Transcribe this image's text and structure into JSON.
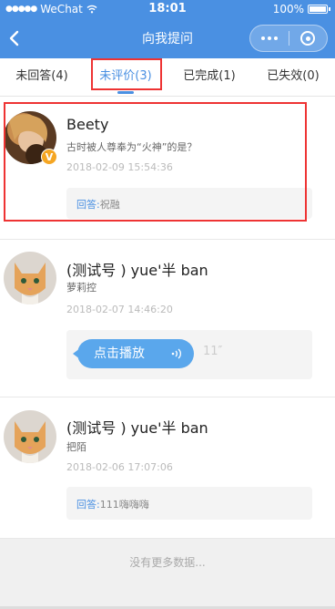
{
  "status_bar": {
    "carrier": "WeChat",
    "time": "18:01",
    "battery_text": "100%",
    "battery_level": 1.0
  },
  "nav": {
    "title": "向我提问",
    "back_icon": "chevron-left-icon",
    "more_icon": "more-dots-icon",
    "close_icon": "target-close-icon"
  },
  "tabs": [
    {
      "label": "未回答(4)",
      "active": false
    },
    {
      "label": "未评价(3)",
      "active": true
    },
    {
      "label": "已完成(1)",
      "active": false
    },
    {
      "label": "已失效(0)",
      "active": false
    }
  ],
  "items": [
    {
      "name": "Beety",
      "question": "古时被人尊奉为“火神”的是？",
      "date": "2018-02-09 15:54:36",
      "verified_badge": "V",
      "answer_label": "回答:",
      "answer_text": "祝融"
    },
    {
      "name": "(测试号 ) yue'半 ban",
      "question": "萝莉控",
      "date": "2018-02-07 14:46:20",
      "voice_label": "点击播放",
      "voice_duration": "11″"
    },
    {
      "name": "(测试号 ) yue'半 ban",
      "question": "把陌",
      "date": "2018-02-06 17:07:06",
      "answer_label": "回答:",
      "answer_text": "111嗨嗨嗨"
    }
  ],
  "footer": {
    "text": "没有更多数据..."
  },
  "colors": {
    "brand": "#4a90e2",
    "highlight": "#ee3333",
    "badge": "#f5a623",
    "voice_bubble": "#5aa7ec"
  }
}
